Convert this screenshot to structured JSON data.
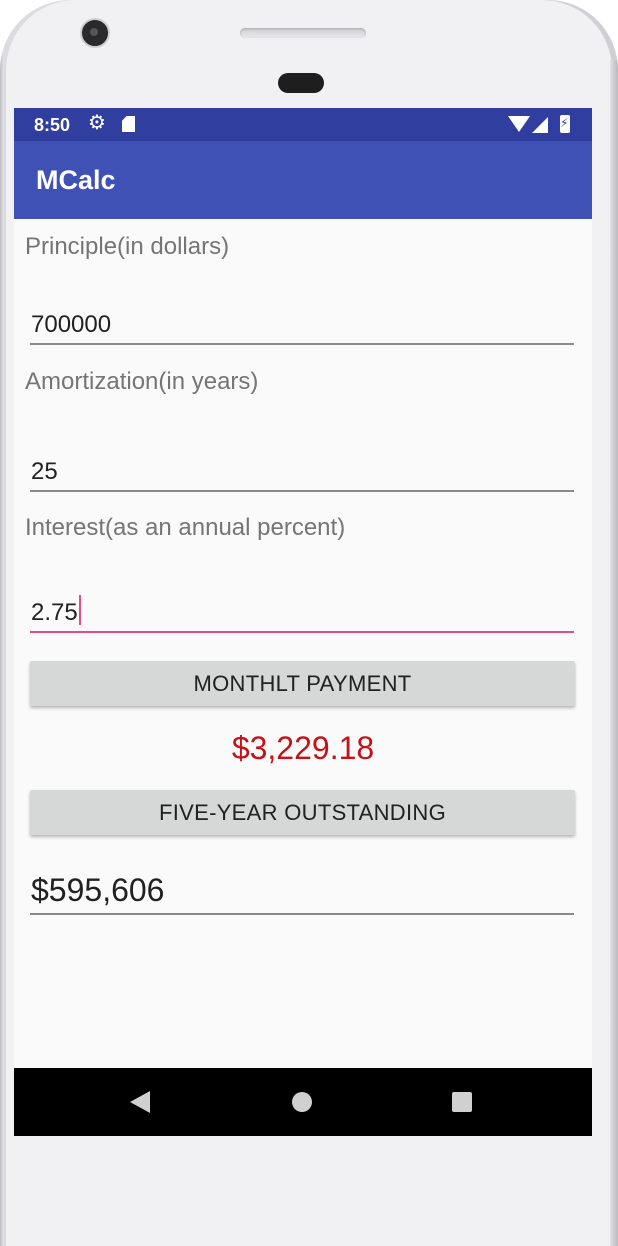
{
  "status_bar": {
    "time": "8:50",
    "icons": [
      "gear-icon",
      "sd-card-icon",
      "wifi-icon",
      "signal-icon",
      "battery-icon"
    ]
  },
  "app_bar": {
    "title": "MCalc"
  },
  "form": {
    "principle_label": "Principle(in dollars)",
    "principle_value": "700000",
    "amortization_label": "Amortization(in years)",
    "amortization_value": "25",
    "interest_label": "Interest(as an annual percent)",
    "interest_value": "2.75"
  },
  "actions": {
    "monthly_payment_label": "MONTHLT PAYMENT",
    "monthly_payment_result": "$3,229.18",
    "five_year_label": "FIVE-YEAR OUTSTANDING",
    "five_year_result": "$595,606"
  },
  "nav_bar": {
    "icons": [
      "back-icon",
      "home-icon",
      "recents-icon"
    ]
  },
  "colors": {
    "status_bar": "#303f9f",
    "app_bar": "#3f51b5",
    "accent": "#e64d87",
    "result_text": "#c41218",
    "button_bg": "#d6d7d7"
  }
}
